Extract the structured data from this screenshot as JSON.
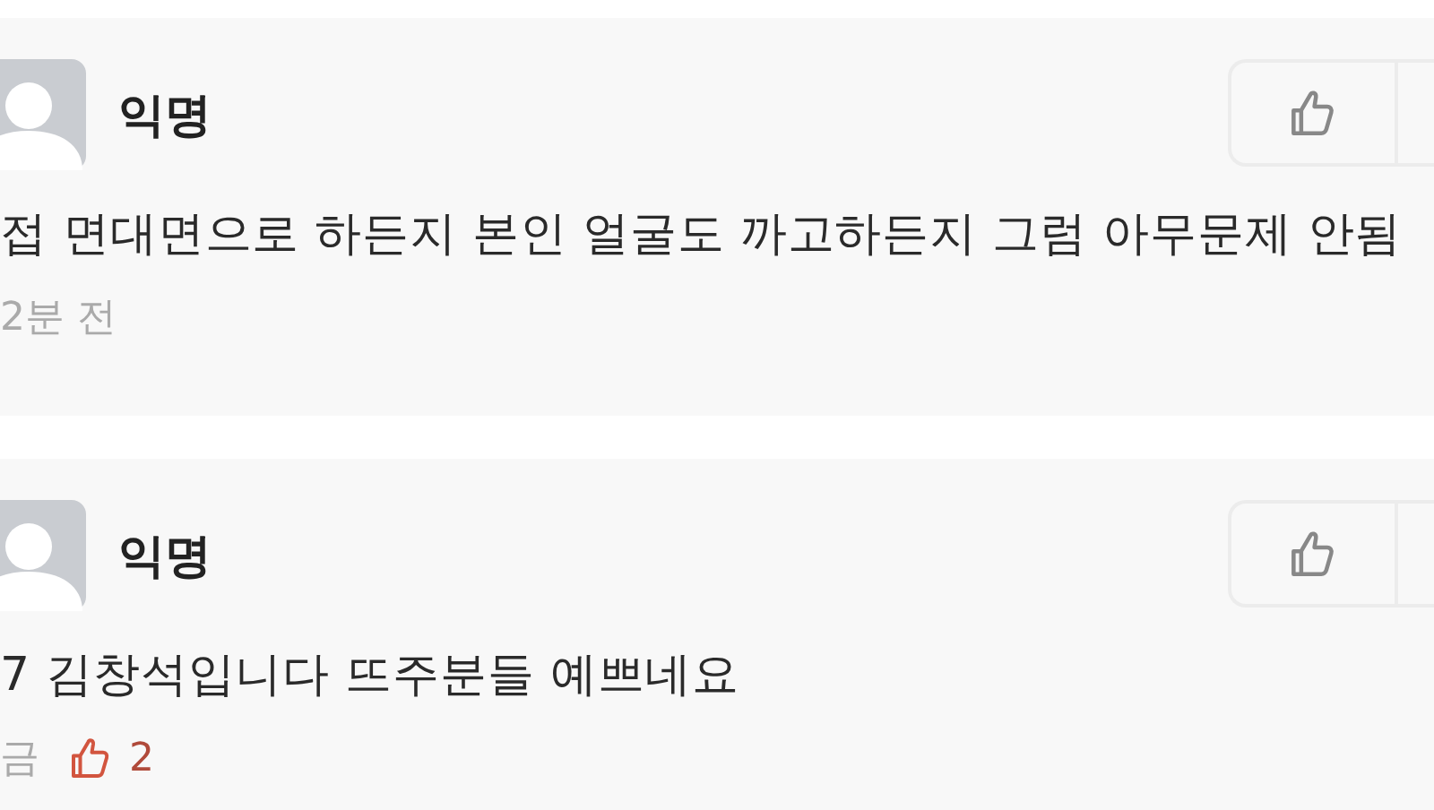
{
  "comments": [
    {
      "author": "익명",
      "text": "접 면대면으로 하든지 본인 얼굴도 까고하든지 그럼 아무문제 안됨",
      "meta": "2분 전"
    },
    {
      "author": "익명",
      "text": "7 김창석입니다 뜨주분들 예쁘네요",
      "meta": "금",
      "likes": "2"
    }
  ]
}
